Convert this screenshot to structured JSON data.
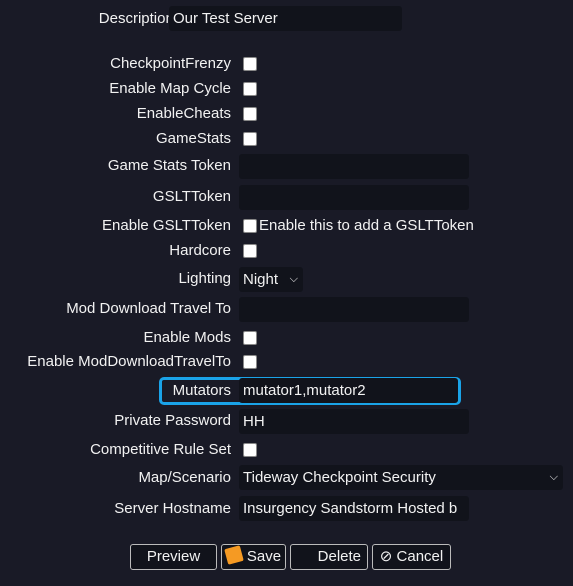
{
  "description": {
    "label": "Description:",
    "value": "Our Test Server"
  },
  "fields": {
    "checkpoint_frenzy": "CheckpointFrenzy",
    "enable_map_cycle": "Enable Map Cycle",
    "enable_cheats": "EnableCheats",
    "game_stats": "GameStats",
    "game_stats_token": "Game Stats Token",
    "gslt_token": "GSLTToken",
    "enable_gslt_token": "Enable GSLTToken",
    "enable_gslt_hint": "Enable this to add a GSLTToken",
    "hardcore": "Hardcore",
    "lighting": "Lighting",
    "lighting_value": "Night",
    "mod_download_travel_to": "Mod Download Travel To",
    "enable_mods": "Enable Mods",
    "enable_mod_download_travel_to": "Enable ModDownloadTravelTo",
    "mutators": "Mutators",
    "mutators_value": "mutator1,mutator2",
    "private_password": "Private Password",
    "private_password_value": "HH",
    "competitive_rule_set": "Competitive Rule Set",
    "map_scenario": "Map/Scenario",
    "map_scenario_value": "Tideway Checkpoint Security",
    "server_hostname": "Server Hostname",
    "server_hostname_value": "Insurgency Sandstorm Hosted b"
  },
  "buttons": {
    "preview": "Preview",
    "save": "Save",
    "delete": "Delete",
    "cancel": "Cancel"
  },
  "colors": {
    "background": "#191a26",
    "focus": "#1aa3e8"
  }
}
